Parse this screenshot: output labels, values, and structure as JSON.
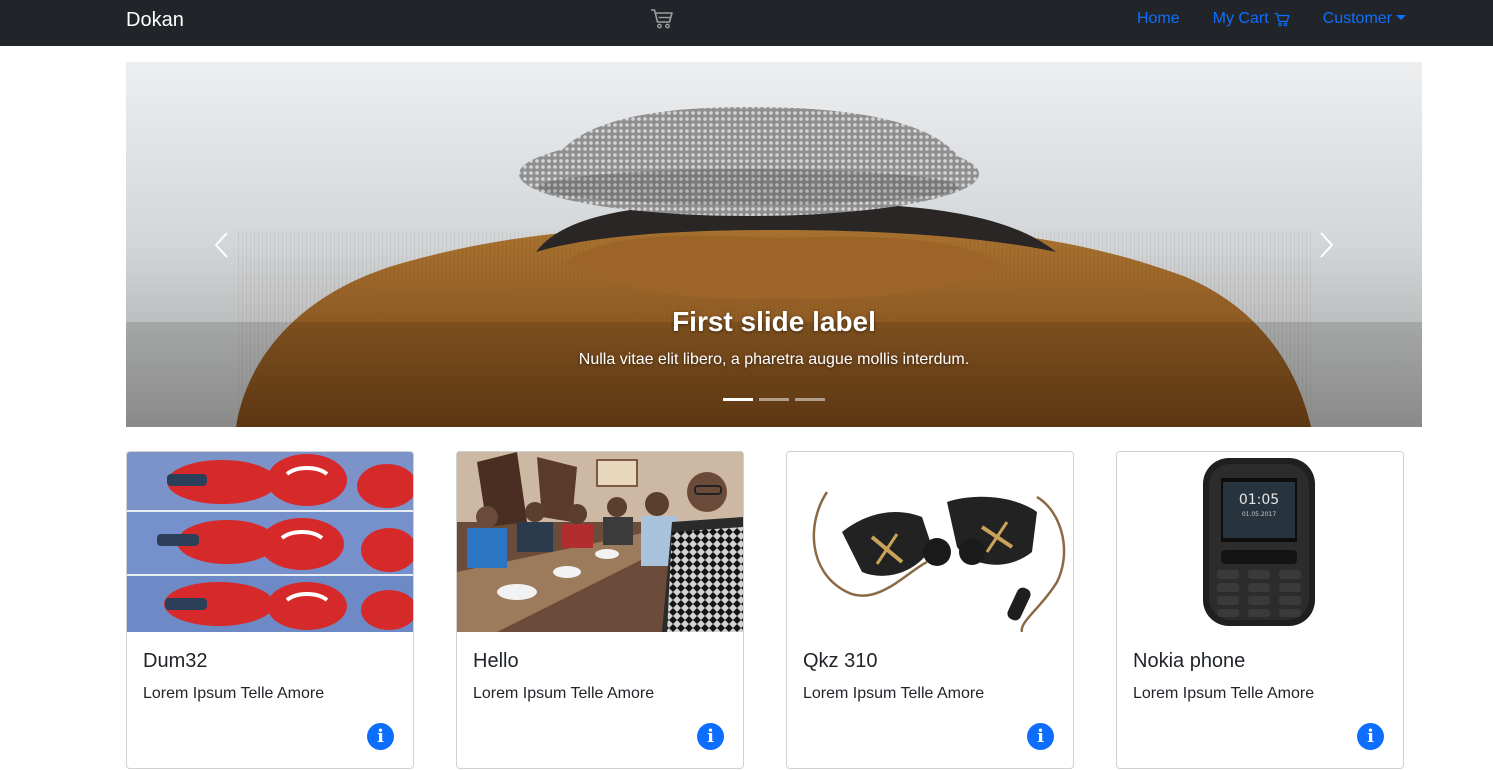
{
  "navbar": {
    "brand": "Dokan",
    "center_icon": "cart-icon",
    "links": [
      {
        "label": "Home"
      },
      {
        "label": "My Cart",
        "icon": "cart-icon"
      },
      {
        "label": "Customer",
        "icon": "caret-down-icon"
      }
    ]
  },
  "carousel": {
    "caption_title": "First slide label",
    "caption_text": "Nulla vitae elit libero, a pharetra augue mollis interdum.",
    "indicators": 3,
    "active_index": 0,
    "prev_icon": "chevron-left-icon",
    "next_icon": "chevron-right-icon"
  },
  "products": [
    {
      "title": "Dum32",
      "text": "Lorem Ipsum Telle Amore",
      "image": "spiderman-meme-image"
    },
    {
      "title": "Hello",
      "text": "Lorem Ipsum Telle Amore",
      "image": "group-dinner-photo"
    },
    {
      "title": "Qkz 310",
      "text": "Lorem Ipsum Telle Amore",
      "image": "earphones-image"
    },
    {
      "title": "Nokia phone",
      "text": "Lorem Ipsum Telle Amore",
      "image": "nokia-phone-image"
    }
  ],
  "colors": {
    "navbar_bg": "#212529",
    "link": "#0d6efd",
    "info_button": "#0d6efd"
  }
}
